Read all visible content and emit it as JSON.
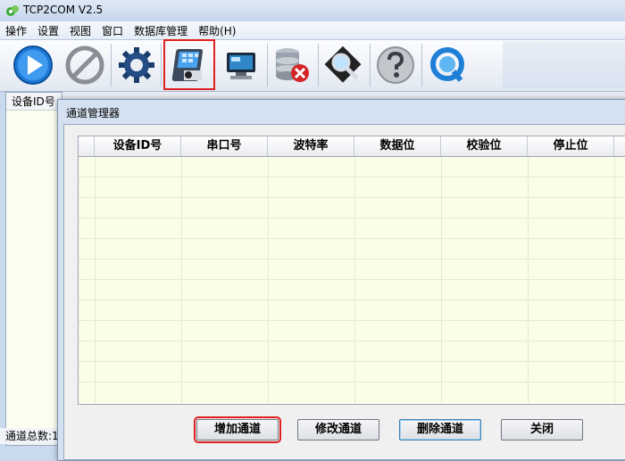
{
  "window": {
    "title": "TCP2COM V2.5"
  },
  "menu": [
    "操作",
    "设置",
    "视图",
    "窗口",
    "数据库管理",
    "帮助(H)"
  ],
  "toolbar": {
    "buttons": [
      {
        "icon": "play-icon"
      },
      {
        "icon": "stop-icon"
      },
      {
        "icon": "gear-icon"
      },
      {
        "icon": "channel-manager-icon",
        "highlighted": true
      },
      {
        "icon": "monitor-icon"
      },
      {
        "icon": "database-delete-icon"
      },
      {
        "icon": "search-icon"
      },
      {
        "icon": "help-icon"
      },
      {
        "icon": "quicktime-icon"
      }
    ]
  },
  "left_panel": {
    "header": "设备ID号",
    "status": "通道总数:1"
  },
  "dialog": {
    "title": "通道管理器",
    "columns": [
      "设备ID号",
      "串口号",
      "波特率",
      "数据位",
      "校验位",
      "停止位"
    ],
    "buttons": {
      "add": "增加通道",
      "modify": "修改通道",
      "delete": "删除通道",
      "close": "关闭"
    }
  },
  "colors": {
    "highlight": "#e02020",
    "grid_bg": "#fbfde6"
  }
}
